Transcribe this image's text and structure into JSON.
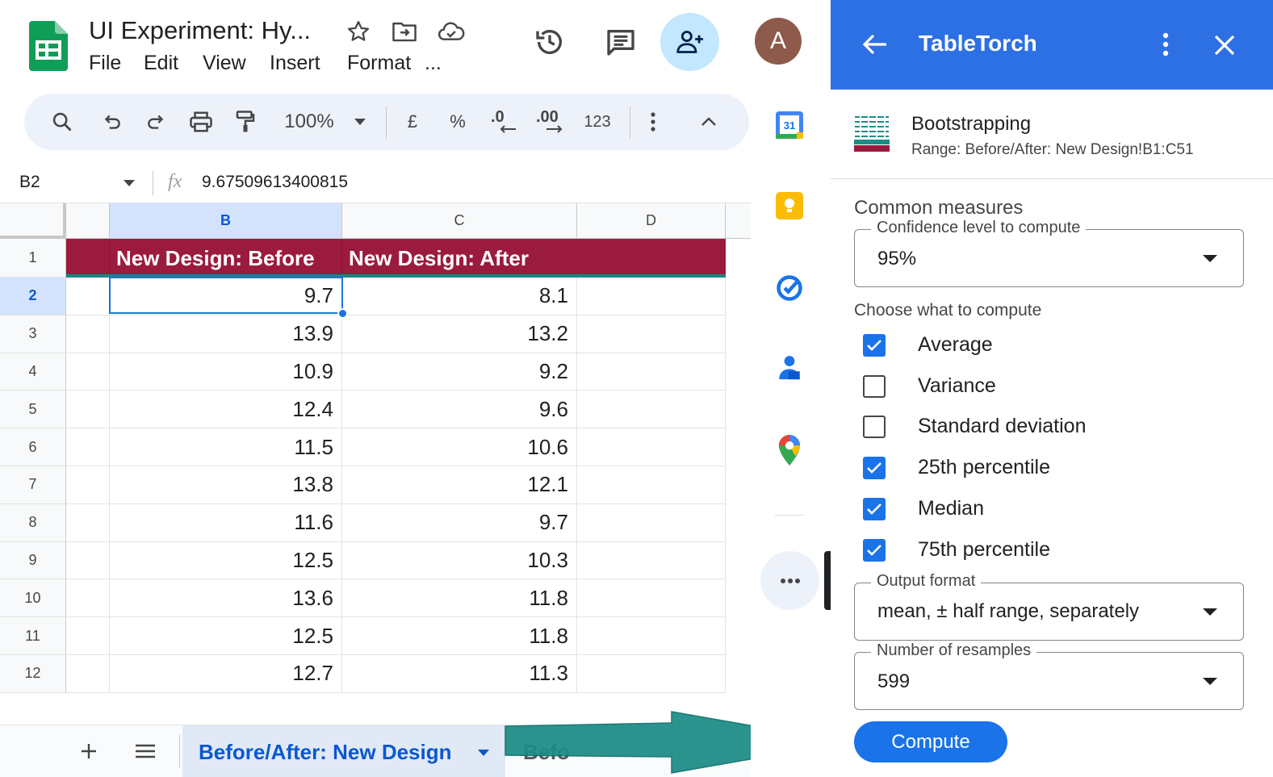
{
  "app": {
    "doc_title": "UI Experiment: Hy...",
    "menu": [
      "File",
      "Edit",
      "View",
      "Insert",
      "Format",
      "..."
    ],
    "avatar_initial": "A"
  },
  "toolbar": {
    "zoom": "100%",
    "currency": "£",
    "percent": "%",
    "decrease_decimals": ".0",
    "increase_decimals": ".00",
    "number_format": "123"
  },
  "formula_bar": {
    "cell_ref": "B2",
    "fx": "fx",
    "value": "9.67509613400815"
  },
  "grid": {
    "columns": [
      "B",
      "C",
      "D"
    ],
    "row_numbers": [
      "1",
      "2",
      "3",
      "4",
      "5",
      "6",
      "7",
      "8",
      "9",
      "10",
      "11",
      "12"
    ],
    "headers": [
      "New Design: Before",
      "New Design: After"
    ],
    "rows": [
      [
        "9.7",
        "8.1"
      ],
      [
        "13.9",
        "13.2"
      ],
      [
        "10.9",
        "9.2"
      ],
      [
        "12.4",
        "9.6"
      ],
      [
        "11.5",
        "10.6"
      ],
      [
        "13.8",
        "12.1"
      ],
      [
        "11.6",
        "9.7"
      ],
      [
        "12.5",
        "10.3"
      ],
      [
        "13.6",
        "11.8"
      ],
      [
        "12.5",
        "11.8"
      ],
      [
        "12.7",
        "11.3"
      ]
    ]
  },
  "sheet_tabs": {
    "active": "Before/After: New Design",
    "partial": "Befo"
  },
  "side_rail": {
    "calendar_day": "31"
  },
  "panel": {
    "title": "TableTorch",
    "tool_name": "Bootstrapping",
    "range": "Range: Before/After: New Design!B1:C51",
    "section_title": "Common measures",
    "confidence_label": "Confidence level to compute",
    "confidence_value": "95%",
    "choose_label": "Choose what to compute",
    "options": [
      {
        "label": "Average",
        "checked": true
      },
      {
        "label": "Variance",
        "checked": false
      },
      {
        "label": "Standard deviation",
        "checked": false
      },
      {
        "label": "25th percentile",
        "checked": true
      },
      {
        "label": "Median",
        "checked": true
      },
      {
        "label": "75th percentile",
        "checked": true
      }
    ],
    "output_label": "Output format",
    "output_value": "mean, ± half range, separately",
    "resamples_label": "Number of resamples",
    "resamples_value": "599",
    "compute_label": "Compute"
  },
  "colors": {
    "header_fill": "#9b1b3e",
    "panel_header": "#2c70e4",
    "accent_blue": "#1a73e8",
    "arrow": "#1c8c86"
  }
}
